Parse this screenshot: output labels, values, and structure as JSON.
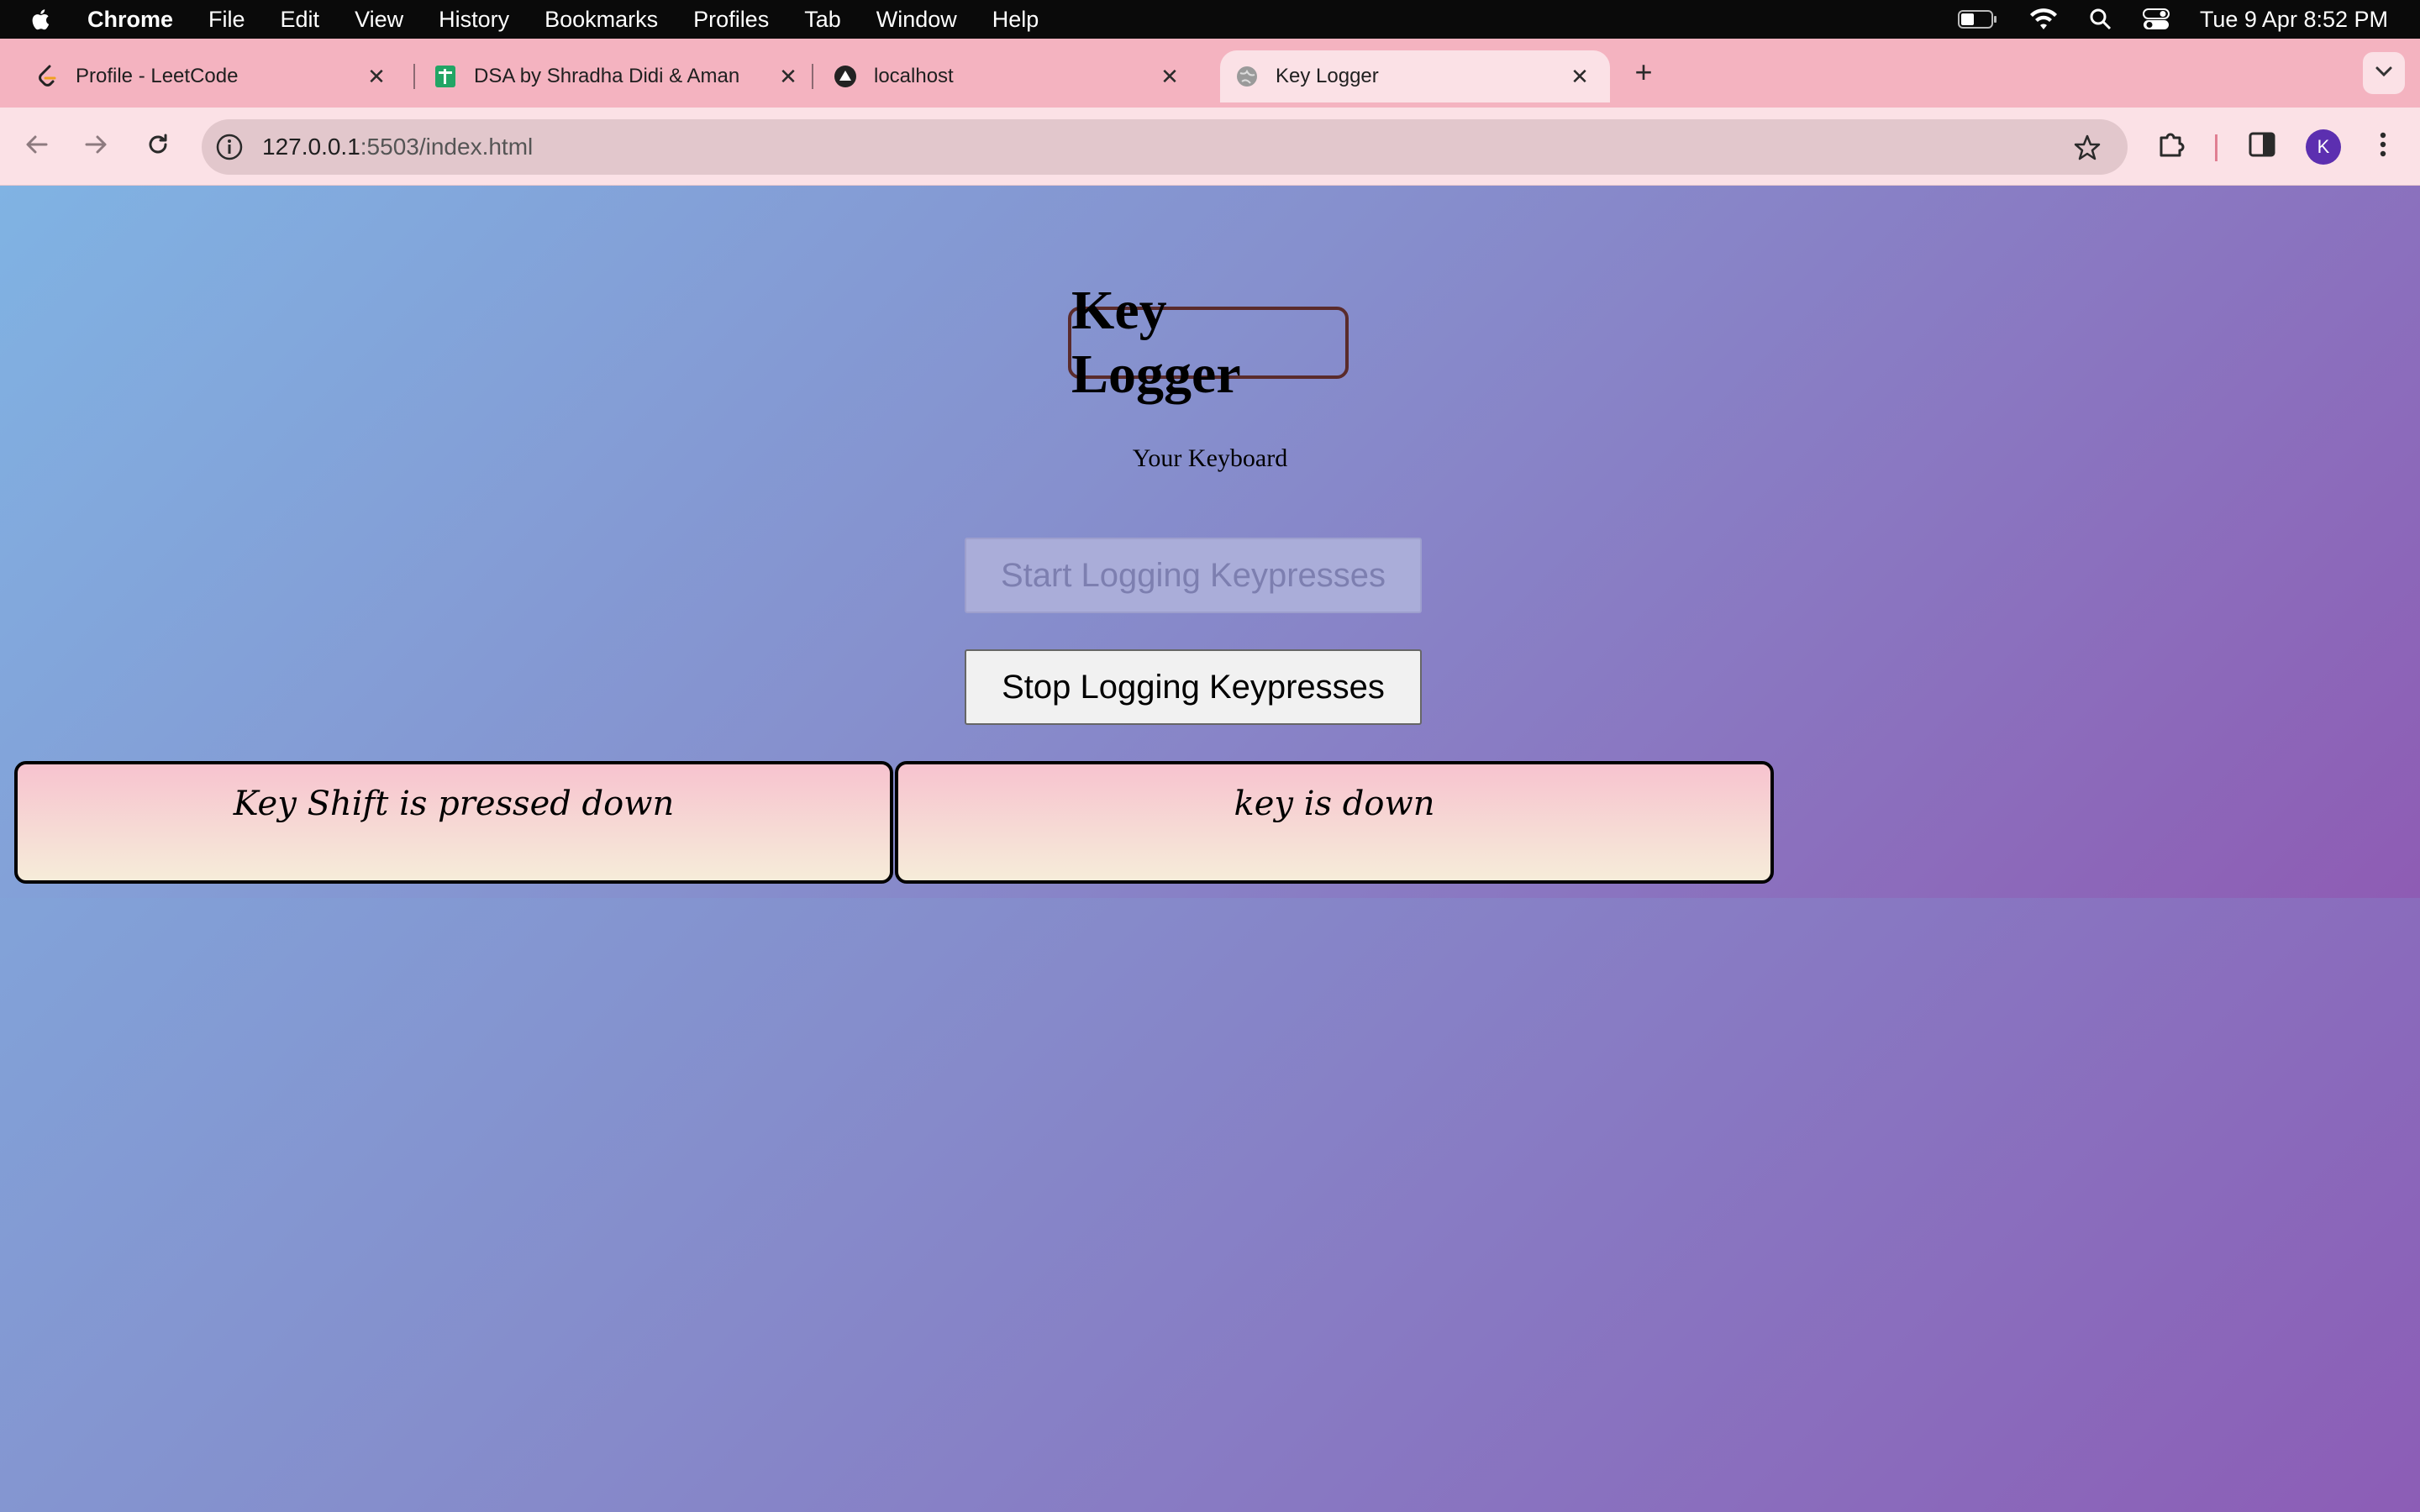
{
  "menubar": {
    "app_name": "Chrome",
    "items": [
      "File",
      "Edit",
      "View",
      "History",
      "Bookmarks",
      "Profiles",
      "Tab",
      "Window",
      "Help"
    ],
    "clock": "Tue 9 Apr  8:52 PM",
    "icons": [
      "apple-icon",
      "battery-icon",
      "wifi-icon",
      "search-icon",
      "control-center-icon"
    ]
  },
  "tabs": [
    {
      "title": "Profile - LeetCode",
      "icon": "leetcode-icon",
      "active": false
    },
    {
      "title": "DSA by Shradha Didi & Aman",
      "icon": "sheets-icon",
      "active": false
    },
    {
      "title": "localhost",
      "icon": "vercel-icon",
      "active": false
    },
    {
      "title": "Key Logger",
      "icon": "globe-icon",
      "active": true
    }
  ],
  "toolbar": {
    "url_host": "127.0.0.1",
    "url_rest": ":5503/index.html"
  },
  "profile": {
    "initial": "K"
  },
  "page": {
    "heading": "Key Logger",
    "subheading": "Your Keyboard",
    "start_button": "Start Logging Keypresses",
    "stop_button": "Stop Logging Keypresses",
    "log_left": "Key Shift is pressed down",
    "log_right": "key is down"
  },
  "colors": {
    "tabstrip": "#f4b3c0",
    "toolbar": "#fbe1e6",
    "gradient_start": "#80b3e3",
    "gradient_end": "#8e5cb4",
    "heading_border": "#5a2b2b"
  }
}
